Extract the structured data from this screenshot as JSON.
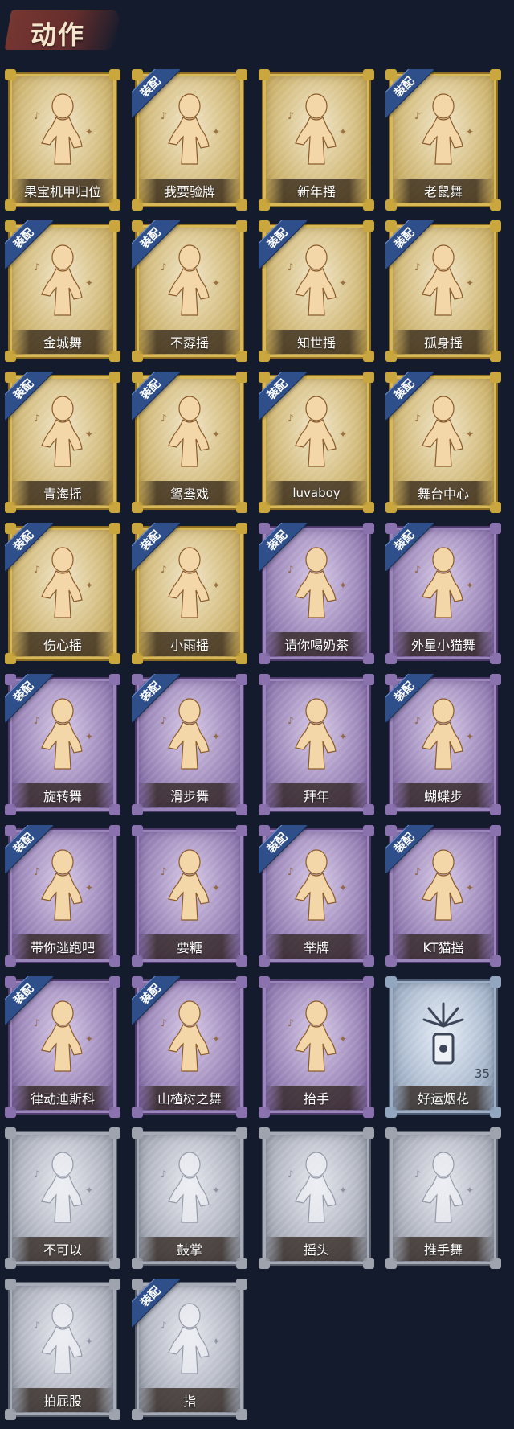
{
  "header": {
    "title": "动作"
  },
  "badge_label": "装配",
  "colors": {
    "gold": "#d9c48c",
    "purple": "#a996c4",
    "silver": "#b9bdc8",
    "blue": "#b5c3d6",
    "badge": "#2f4f8a",
    "figure_gold": "#f3d7a8",
    "figure_purple": "#f3d7a8",
    "figure_silver": "#e4e7ee"
  },
  "actions": [
    {
      "label": "果宝机甲归位",
      "tier": "gold",
      "equipped": false,
      "icon": "dance-pose-icon"
    },
    {
      "label": "我要验牌",
      "tier": "gold",
      "equipped": true,
      "icon": "dance-pose-icon"
    },
    {
      "label": "新年摇",
      "tier": "gold",
      "equipped": false,
      "icon": "dance-pose-icon"
    },
    {
      "label": "老鼠舞",
      "tier": "gold",
      "equipped": true,
      "icon": "dance-pose-icon"
    },
    {
      "label": "金城舞",
      "tier": "gold",
      "equipped": true,
      "icon": "dance-pose-icon"
    },
    {
      "label": "不孬摇",
      "tier": "gold",
      "equipped": true,
      "icon": "dance-pose-icon"
    },
    {
      "label": "知世摇",
      "tier": "gold",
      "equipped": true,
      "icon": "dance-pose-icon"
    },
    {
      "label": "孤身摇",
      "tier": "gold",
      "equipped": true,
      "icon": "dance-pose-icon"
    },
    {
      "label": "青海摇",
      "tier": "gold",
      "equipped": true,
      "icon": "dance-pose-icon"
    },
    {
      "label": "鸳鸯戏",
      "tier": "gold",
      "equipped": true,
      "icon": "dance-pose-icon"
    },
    {
      "label": "luvaboy",
      "tier": "gold",
      "equipped": true,
      "icon": "dance-pose-icon"
    },
    {
      "label": "舞台中心",
      "tier": "gold",
      "equipped": true,
      "icon": "dance-pose-icon"
    },
    {
      "label": "伤心摇",
      "tier": "gold",
      "equipped": true,
      "icon": "heart-hands-pose-icon"
    },
    {
      "label": "小雨摇",
      "tier": "gold",
      "equipped": true,
      "icon": "dance-pose-icon"
    },
    {
      "label": "请你喝奶茶",
      "tier": "purple",
      "equipped": true,
      "icon": "milk-tea-pose-icon"
    },
    {
      "label": "外星小猫舞",
      "tier": "purple",
      "equipped": true,
      "icon": "dance-pose-icon"
    },
    {
      "label": "旋转舞",
      "tier": "purple",
      "equipped": true,
      "icon": "spin-pose-icon"
    },
    {
      "label": "滑步舞",
      "tier": "purple",
      "equipped": true,
      "icon": "dance-pose-icon"
    },
    {
      "label": "拜年",
      "tier": "purple",
      "equipped": false,
      "icon": "bow-pose-icon"
    },
    {
      "label": "蝴蝶步",
      "tier": "purple",
      "equipped": true,
      "icon": "dance-pose-icon"
    },
    {
      "label": "带你逃跑吧",
      "tier": "purple",
      "equipped": true,
      "icon": "point-pose-icon"
    },
    {
      "label": "要糖",
      "tier": "purple",
      "equipped": false,
      "icon": "beg-pose-icon"
    },
    {
      "label": "举牌",
      "tier": "purple",
      "equipped": true,
      "icon": "sign-pose-icon"
    },
    {
      "label": "KT猫摇",
      "tier": "purple",
      "equipped": true,
      "icon": "dance-pose-icon"
    },
    {
      "label": "律动迪斯科",
      "tier": "purple",
      "equipped": true,
      "icon": "disco-pose-icon"
    },
    {
      "label": "山楂树之舞",
      "tier": "purple",
      "equipped": true,
      "icon": "dance-pose-icon"
    },
    {
      "label": "抬手",
      "tier": "purple",
      "equipped": false,
      "icon": "raise-hand-pose-icon"
    },
    {
      "label": "好运烟花",
      "tier": "blue",
      "equipped": false,
      "icon": "firework-icon",
      "count": "35"
    },
    {
      "label": "不可以",
      "tier": "silver",
      "equipped": false,
      "icon": "finger-wag-icon"
    },
    {
      "label": "鼓掌",
      "tier": "silver",
      "equipped": false,
      "icon": "clap-icon"
    },
    {
      "label": "摇头",
      "tier": "silver",
      "equipped": false,
      "icon": "head-shake-pose-icon"
    },
    {
      "label": "推手舞",
      "tier": "silver",
      "equipped": false,
      "icon": "push-hands-pose-icon"
    },
    {
      "label": "拍屁股",
      "tier": "silver",
      "equipped": false,
      "icon": "butt-pat-pose-icon"
    },
    {
      "label": "指",
      "tier": "silver",
      "equipped": true,
      "icon": "point-hand-icon"
    }
  ]
}
